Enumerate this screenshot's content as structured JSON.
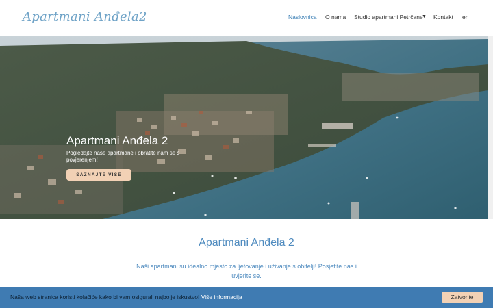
{
  "brand": {
    "logo_text": "Apartmani Anđela2"
  },
  "nav": {
    "items": [
      {
        "label": "Naslovnica",
        "active": true
      },
      {
        "label": "O nama"
      },
      {
        "label": "Studio apartmani Petrčane",
        "caret": "▼"
      },
      {
        "label": "Kontakt"
      },
      {
        "label": "en"
      }
    ]
  },
  "hero": {
    "title": "Apartmani Anđela 2",
    "subtitle": "Pogledajte naše apartmane i obratite nam se s povjerenjem!",
    "button_label": "SAZNAJTE VIŠE"
  },
  "intro": {
    "title": "Apartmani Anđela 2",
    "text": "Naši apartmani su idealno mjesto za ljetovanje i uživanje s obitelji! Posjetite nas i uvjerite se."
  },
  "cookie_bar": {
    "message": "Naša web stranica koristi kolačiće kako bi vam osigurali najbolje iskustvo!",
    "link_label": "Više informacija",
    "accept_label": "Zatvorite"
  },
  "colors": {
    "accent": "#3b7fb5",
    "button_peach": "#f2d1b5",
    "cookie_bar": "#3f7bb2",
    "sea": "#3e6f82"
  }
}
